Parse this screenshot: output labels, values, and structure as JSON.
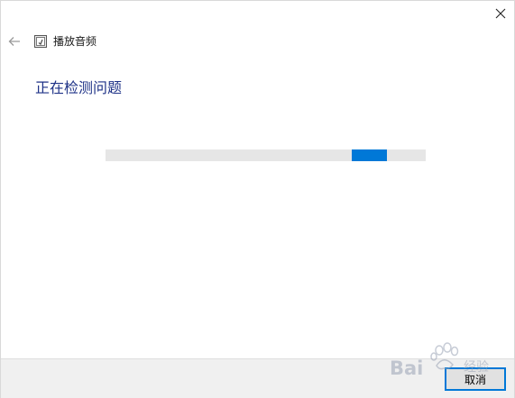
{
  "window": {
    "title": "播放音频",
    "close_glyph": "✕"
  },
  "nav": {
    "back_glyph": "←"
  },
  "status": {
    "heading": "正在检测问题"
  },
  "progress": {
    "indeterminate": true,
    "indicator_position_fraction": 0.77,
    "indicator_width_fraction": 0.11,
    "track_color": "#e6e6e6",
    "fill_color": "#0078d7"
  },
  "footer": {
    "cancel_label": "取消"
  },
  "watermark": {
    "text_latin": "Bai",
    "text_cn": "经验",
    "color": "#9aa3b5"
  },
  "colors": {
    "accent": "#0078d7",
    "heading": "#1e3287",
    "footer_bg": "#f0f0f0"
  }
}
